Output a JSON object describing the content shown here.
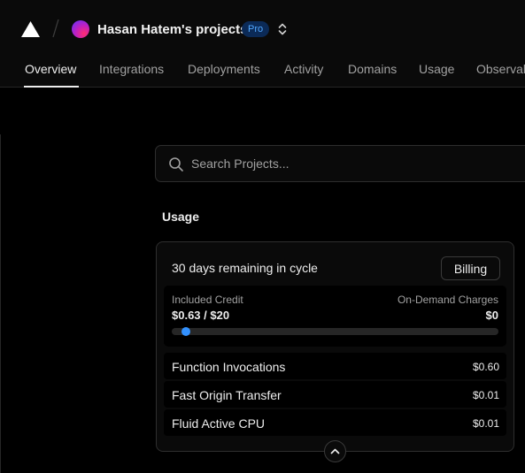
{
  "header": {
    "team_name": "Hasan Hatem's projects",
    "plan_badge": "Pro",
    "accent_color": "#52a8ff",
    "icons": [
      "vercel-logo-icon",
      "team-avatar",
      "chevron-up-down-icon"
    ]
  },
  "tabs": [
    {
      "label": "Overview",
      "active": true
    },
    {
      "label": "Integrations",
      "active": false
    },
    {
      "label": "Deployments",
      "active": false
    },
    {
      "label": "Activity",
      "active": false
    },
    {
      "label": "Domains",
      "active": false
    },
    {
      "label": "Usage",
      "active": false
    },
    {
      "label": "Observability",
      "active": false
    }
  ],
  "search": {
    "placeholder": "Search Projects..."
  },
  "usage": {
    "title": "Usage",
    "cycle_text": "30 days remaining in cycle",
    "billing_label": "Billing",
    "included_credit_label": "Included Credit",
    "included_credit_value": "$0.63 / $20",
    "on_demand_label": "On-Demand Charges",
    "on_demand_value": "$0",
    "credit_progress_fraction": 0.0315,
    "progress_color": "#3291ff",
    "items": [
      {
        "label": "Function Invocations",
        "value": "$0.60"
      },
      {
        "label": "Fast Origin Transfer",
        "value": "$0.01"
      },
      {
        "label": "Fluid Active CPU",
        "value": "$0.01"
      }
    ]
  }
}
